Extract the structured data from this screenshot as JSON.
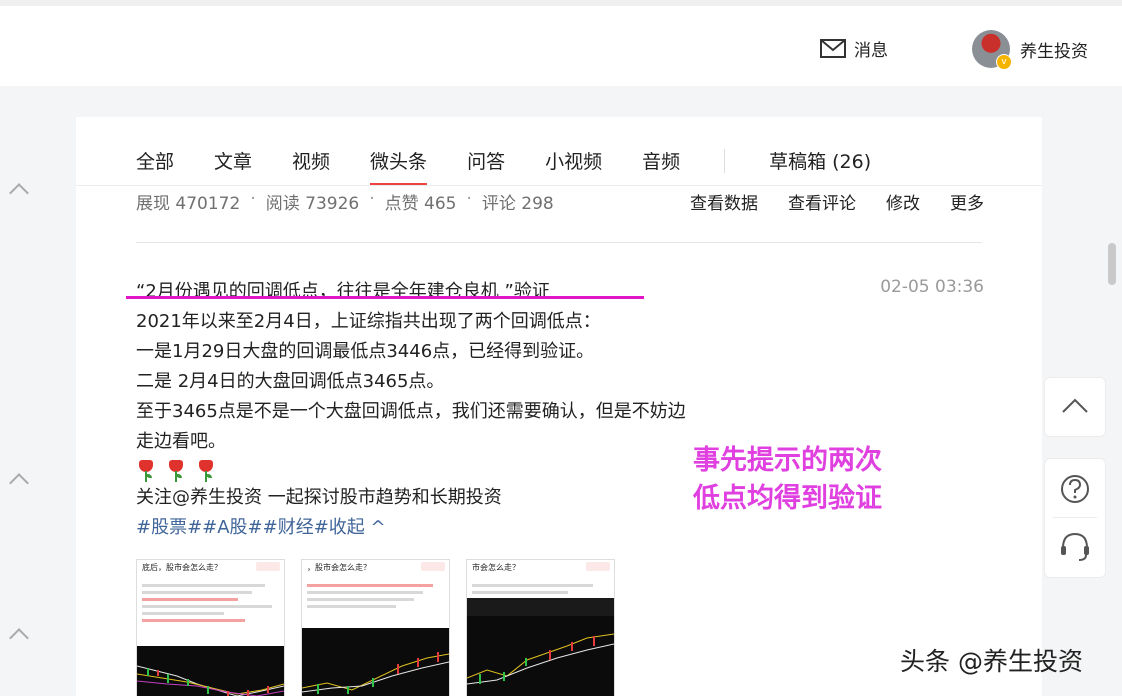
{
  "header": {
    "messages_label": "消息",
    "username": "养生投资"
  },
  "tabs": [
    {
      "label": "全部"
    },
    {
      "label": "文章"
    },
    {
      "label": "视频"
    },
    {
      "label": "微头条"
    },
    {
      "label": "问答"
    },
    {
      "label": "小视频"
    },
    {
      "label": "音频"
    }
  ],
  "drafts_label": "草稿箱 (26)",
  "active_tab": "微头条",
  "stats": {
    "impressions": "展现 470172",
    "reads": "阅读 73926",
    "likes": "点赞 465",
    "comments": "评论 298",
    "separator": "·"
  },
  "actions": {
    "view_data": "查看数据",
    "view_comments": "查看评论",
    "edit": "修改",
    "more": "更多"
  },
  "post": {
    "title": "“2月份遇见的回调低点，往往是全年建仓良机  ”验证",
    "date": "02-05 03:36",
    "lines": [
      "2021年以来至2月4日，上证综指共出现了两个回调低点：",
      "一是1月29日大盘的回调最低点3446点，已经得到验证。",
      "二是 2月4日的大盘回调低点3465点。",
      "至于3465点是不是一个大盘回调低点，我们还需要确认，但是不妨边",
      "走边看吧。"
    ],
    "follow_line": "关注@养生投资        一起探讨股市趋势和长期投资",
    "tags": "#股票##A股##财经#收起 ^"
  },
  "annotation": [
    "事先提示的两次",
    "低点均得到验证"
  ],
  "thumbnails": [
    {
      "title": "底后，股市会怎么走？"
    },
    {
      "title": "，股市会怎么走？"
    },
    {
      "title": "市会怎么走？"
    }
  ],
  "watermark": "头条 @养生投资",
  "colors": {
    "accent_red": "#f04142",
    "annotation_magenta": "#e040e0",
    "underline_magenta": "#e016c8",
    "tag_blue": "#406599"
  }
}
